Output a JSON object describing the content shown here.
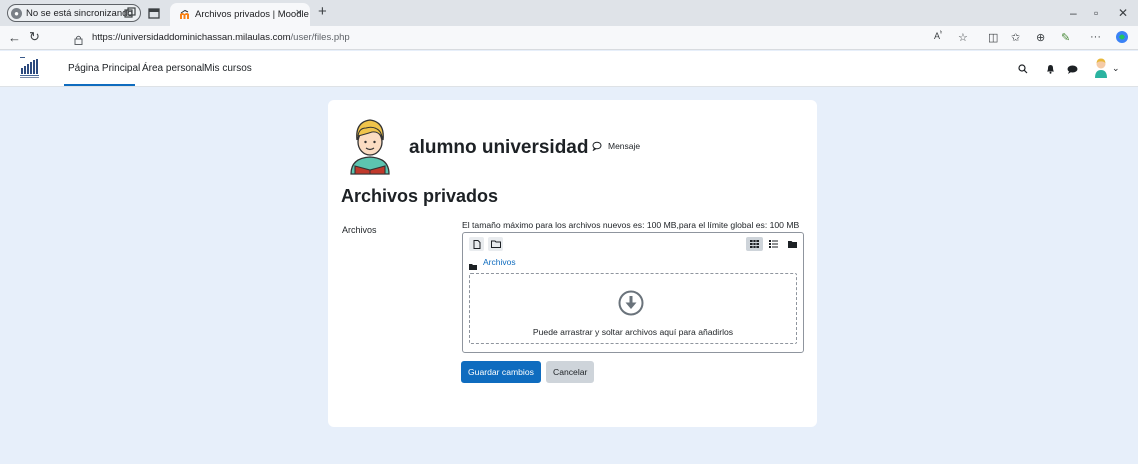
{
  "browser": {
    "profile_label": "No se está sincronizando",
    "tab_title": "Archivos privados | Moodle",
    "tab_close": "×",
    "new_tab": "+",
    "url_host": "https://universidaddominichassan.milaulas.com",
    "url_path": "/user/files.php",
    "minimize": "–",
    "maximize": "▫",
    "close": "✕"
  },
  "header": {
    "nav": [
      "Página Principal",
      "Área personal",
      "Mis cursos"
    ]
  },
  "profile": {
    "name": "alumno universidad",
    "message_label": "Mensaje"
  },
  "page": {
    "title": "Archivos privados",
    "field_label": "Archivos",
    "max_size_note": "El tamaño máximo para los archivos nuevos es: 100 MB,para el límite global es: 100 MB",
    "breadcrumb": "Archivos",
    "dropzone_text": "Puede arrastrar y soltar archivos aquí para añadirlos"
  },
  "buttons": {
    "save": "Guardar cambios",
    "cancel": "Cancelar"
  },
  "colors": {
    "accent": "#0f6cbf",
    "page_bg": "#e7effa"
  }
}
